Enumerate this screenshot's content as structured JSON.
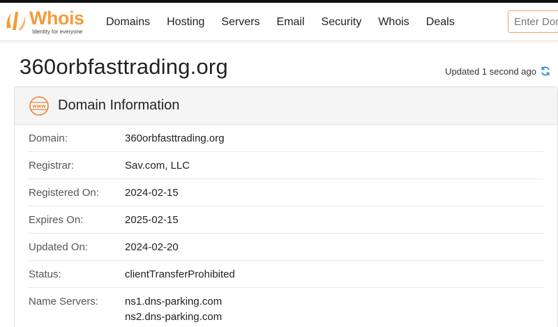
{
  "brand": {
    "name": "Whois",
    "tagline": "Identity for everyone",
    "accent": "#f39c3b"
  },
  "nav": {
    "items": [
      "Domains",
      "Hosting",
      "Servers",
      "Email",
      "Security",
      "Whois",
      "Deals"
    ]
  },
  "search": {
    "placeholder": "Enter Domain"
  },
  "page": {
    "title": "360orbfasttrading.org",
    "updated": "Updated 1 second ago"
  },
  "card": {
    "heading": "Domain Information",
    "rows": [
      {
        "label": "Domain:",
        "values": [
          "360orbfasttrading.org"
        ]
      },
      {
        "label": "Registrar:",
        "values": [
          "Sav.com, LLC"
        ]
      },
      {
        "label": "Registered On:",
        "values": [
          "2024-02-15"
        ]
      },
      {
        "label": "Expires On:",
        "values": [
          "2025-02-15"
        ]
      },
      {
        "label": "Updated On:",
        "values": [
          "2024-02-20"
        ]
      },
      {
        "label": "Status:",
        "values": [
          "clientTransferProhibited"
        ]
      },
      {
        "label": "Name Servers:",
        "values": [
          "ns1.dns-parking.com",
          "ns2.dns-parking.com"
        ]
      }
    ]
  },
  "icons": {
    "logo": "whois-logo-icon",
    "refresh": "refresh-icon",
    "www": "www-globe-icon"
  }
}
